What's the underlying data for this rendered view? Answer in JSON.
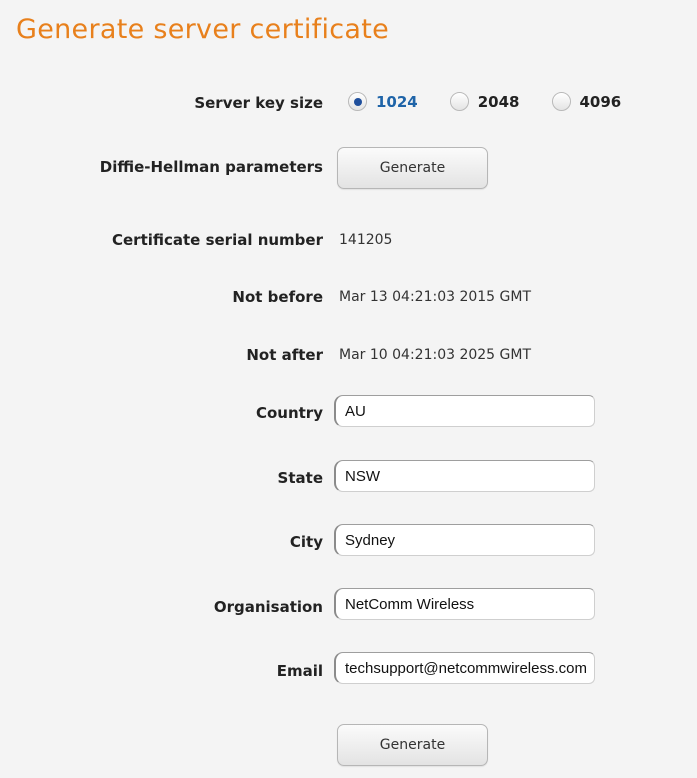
{
  "page": {
    "title": "Generate server certificate"
  },
  "server_key_size": {
    "label": "Server key size",
    "options": [
      {
        "label": "1024",
        "selected": true
      },
      {
        "label": "2048",
        "selected": false
      },
      {
        "label": "4096",
        "selected": false
      }
    ]
  },
  "diffie_hellman": {
    "label": "Diffie-Hellman parameters",
    "button_label": "Generate"
  },
  "serial": {
    "label": "Certificate serial number",
    "value": "141205"
  },
  "not_before": {
    "label": "Not before",
    "value": "Mar 13 04:21:03 2015 GMT"
  },
  "not_after": {
    "label": "Not after",
    "value": "Mar 10 04:21:03 2025 GMT"
  },
  "country": {
    "label": "Country",
    "value": "AU"
  },
  "state": {
    "label": "State",
    "value": "NSW"
  },
  "city": {
    "label": "City",
    "value": "Sydney"
  },
  "organisation": {
    "label": "Organisation",
    "value": "NetComm Wireless"
  },
  "email": {
    "label": "Email",
    "value": "techsupport@netcommwireless.com"
  },
  "submit": {
    "button_label": "Generate"
  },
  "colors": {
    "title": "#e8801c",
    "selected_radio": "#1f64a8",
    "background": "#f4f4f4"
  }
}
